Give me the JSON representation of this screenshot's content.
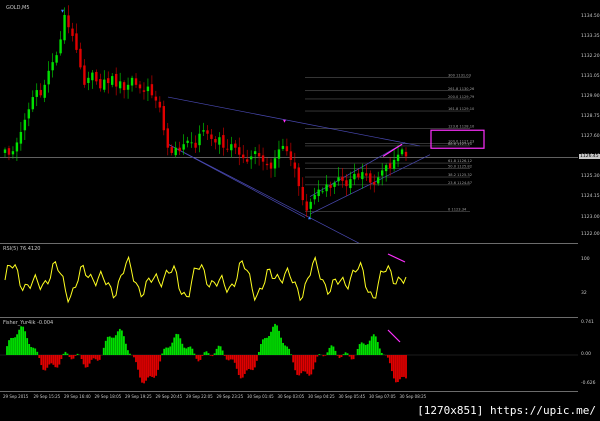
{
  "main": {
    "symbol": "GOLD,M5",
    "price_scale": [
      "1134.50",
      "1133.35",
      "1132.20",
      "1131.05",
      "1129.90",
      "1128.75",
      "1127.60",
      "1126.45",
      "1125.30",
      "1124.15",
      "1123.00",
      "1122.00"
    ],
    "current_price": "1126.45",
    "fib_levels": [
      {
        "label": "300 1131.03",
        "price": 1131.03
      },
      {
        "label": "261.8 1130.26",
        "price": 1130.26
      },
      {
        "label": "200.0 1129.79",
        "price": 1129.79
      },
      {
        "label": "161.8 1129.10",
        "price": 1129.1
      },
      {
        "label": "123.6 1128.10",
        "price": 1128.1
      },
      {
        "label": "100.0 1127.23",
        "price": 1127.23
      },
      {
        "label": "88.6 1127.10",
        "price": 1127.1
      },
      {
        "label": "61.8 1126.12",
        "price": 1126.12
      },
      {
        "label": "50.0 1125.82",
        "price": 1125.82
      },
      {
        "label": "38.2 1125.32",
        "price": 1125.32
      },
      {
        "label": "23.6 1124.87",
        "price": 1124.87
      },
      {
        "label": "0 1123.34",
        "price": 1123.34
      }
    ]
  },
  "rsi": {
    "title": "RSI(5) 76.4120",
    "scale": [
      "100",
      "32",
      "0"
    ]
  },
  "fisher": {
    "title": "Fisher_Yur4ik -0.004",
    "scale": [
      "0.741",
      "0.00",
      "-0.626"
    ]
  },
  "time_axis": [
    "29 Sep 2015",
    "29 Sep 15:25",
    "29 Sep 16:40",
    "29 Sep 18:05",
    "29 Sep 19:25",
    "29 Sep 20:45",
    "29 Sep 22:05",
    "29 Sep 23:25",
    "30 Sep 01:45",
    "30 Sep 03:05",
    "30 Sep 04:25",
    "30 Sep 05:45",
    "30 Sep 07:05",
    "30 Sep 08:25"
  ],
  "watermark": "[1270x851] https://upic.me/",
  "colors": {
    "bull": "#00e000",
    "bear": "#e00000",
    "rsi_line": "#ffff20",
    "magenta": "#ff30ff",
    "arrow": "#3a7fff",
    "channel": "#4a4ab4",
    "fib": "#6a6a6a"
  },
  "chart_data": {
    "type": "candlestick",
    "title": "GOLD,M5",
    "ylim": [
      1122.0,
      1135.0
    ],
    "close_path": [
      1126.9,
      1126.6,
      1126.8,
      1127.3,
      1127.9,
      1128.6,
      1129.2,
      1129.9,
      1130.3,
      1130.0,
      1130.6,
      1131.4,
      1131.9,
      1132.3,
      1133.2,
      1134.6,
      1133.9,
      1133.4,
      1132.6,
      1131.6,
      1130.6,
      1131.0,
      1131.3,
      1130.8,
      1130.4,
      1130.9,
      1130.7,
      1131.1,
      1130.5,
      1130.8,
      1130.3,
      1130.6,
      1131.0,
      1130.6,
      1130.4,
      1130.2,
      1130.5,
      1130.0,
      1129.7,
      1129.3,
      1128.0,
      1127.0,
      1126.7,
      1127.0,
      1126.8,
      1127.2,
      1127.4,
      1127.3,
      1127.0,
      1127.8,
      1128.0,
      1127.8,
      1127.5,
      1127.3,
      1127.6,
      1127.0,
      1126.9,
      1127.2,
      1127.0,
      1126.6,
      1126.4,
      1126.2,
      1126.5,
      1126.8,
      1126.5,
      1126.2,
      1126.0,
      1125.8,
      1126.4,
      1126.9,
      1127.1,
      1126.8,
      1126.3,
      1125.8,
      1124.8,
      1124.0,
      1123.4,
      1123.9,
      1124.3,
      1124.6,
      1124.5,
      1124.9,
      1124.7,
      1125.0,
      1125.3,
      1125.1,
      1124.8,
      1125.2,
      1125.5,
      1125.3,
      1125.6,
      1125.4,
      1125.0,
      1124.9,
      1125.3,
      1125.7,
      1126.0,
      1125.8,
      1126.3,
      1126.6,
      1126.9,
      1126.5
    ],
    "annotations": [
      "Fibonacci expansion levels",
      "Descending channel",
      "Rising channel",
      "RSI divergence",
      "Fisher divergence"
    ]
  }
}
